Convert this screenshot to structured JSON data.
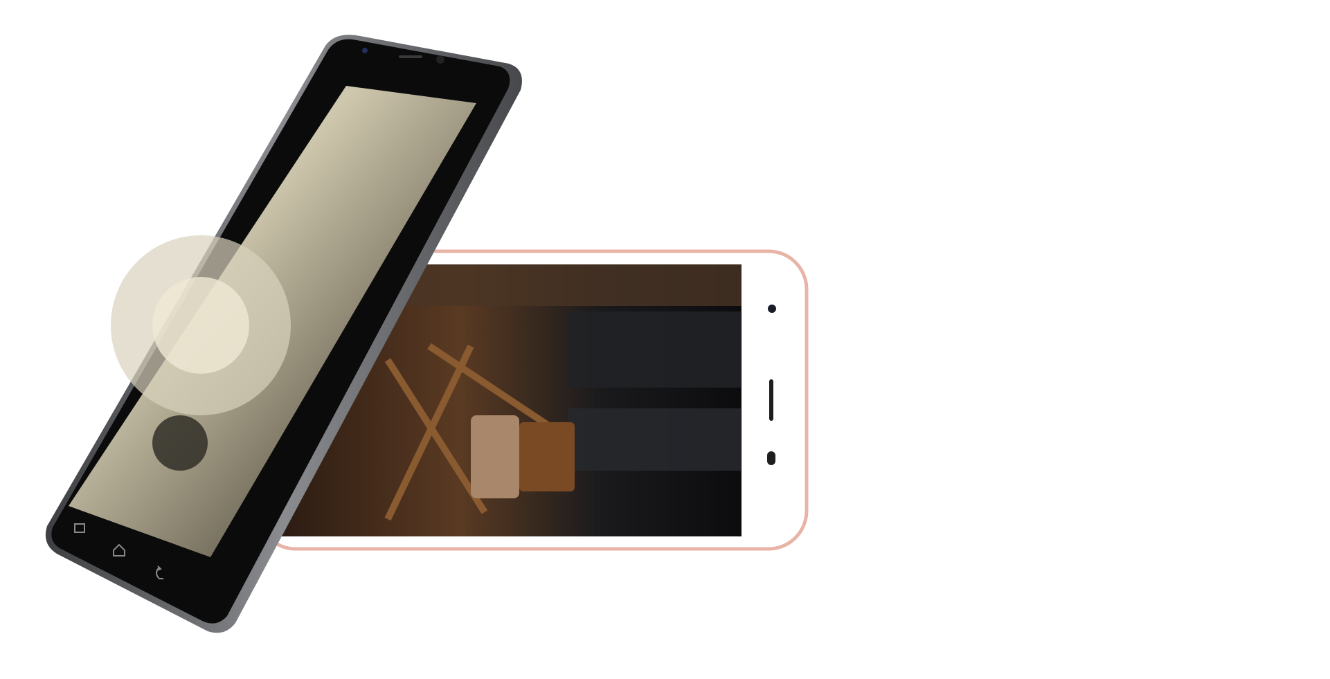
{
  "colors": {
    "background": "#ffffff",
    "white_phone_frame": "#e8b4a8",
    "white_phone_body": "#ffffff",
    "dark_phone_frame": "#5e6063",
    "dark_phone_face": "#0b0b0c",
    "screen_dark": "#141210",
    "screen_sepia": "#b9b29a"
  }
}
